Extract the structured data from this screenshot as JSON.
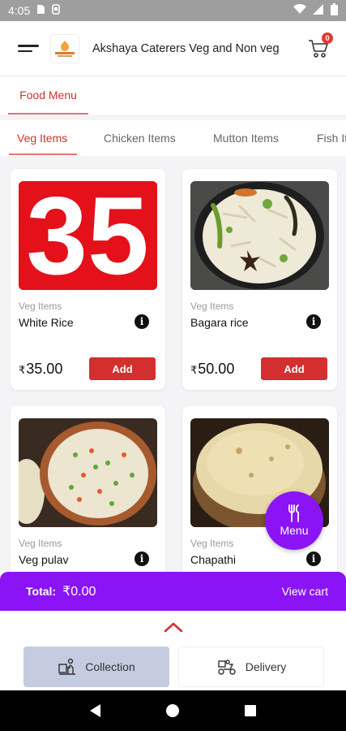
{
  "status_bar": {
    "time": "4:05"
  },
  "app_bar": {
    "title": "Akshaya Caterers Veg and Non veg",
    "cart_count": "0"
  },
  "menu_tab": {
    "label": "Food Menu"
  },
  "category_tabs": [
    {
      "label": "Veg Items",
      "active": true
    },
    {
      "label": "Chicken Items",
      "active": false
    },
    {
      "label": "Mutton Items",
      "active": false
    },
    {
      "label": "Fish Items",
      "active": false
    }
  ],
  "products": [
    {
      "category": "Veg Items",
      "name": "White Rice",
      "currency": "₹",
      "price": "35.00",
      "add_label": "Add",
      "image_text": "35"
    },
    {
      "category": "Veg Items",
      "name": "Bagara rice",
      "currency": "₹",
      "price": "50.00",
      "add_label": "Add"
    },
    {
      "category": "Veg Items",
      "name": "Veg pulav"
    },
    {
      "category": "Veg Items",
      "name": "Chapathi"
    }
  ],
  "fab": {
    "label": "Menu"
  },
  "total_bar": {
    "label": "Total:",
    "value": "₹0.00",
    "view_cart_label": "View cart"
  },
  "order_options": {
    "collection_label": "Collection",
    "delivery_label": "Delivery"
  },
  "colors": {
    "accent": "#d32f2f",
    "primary": "#8a14f5",
    "collection_bg": "#c5cbe0"
  }
}
